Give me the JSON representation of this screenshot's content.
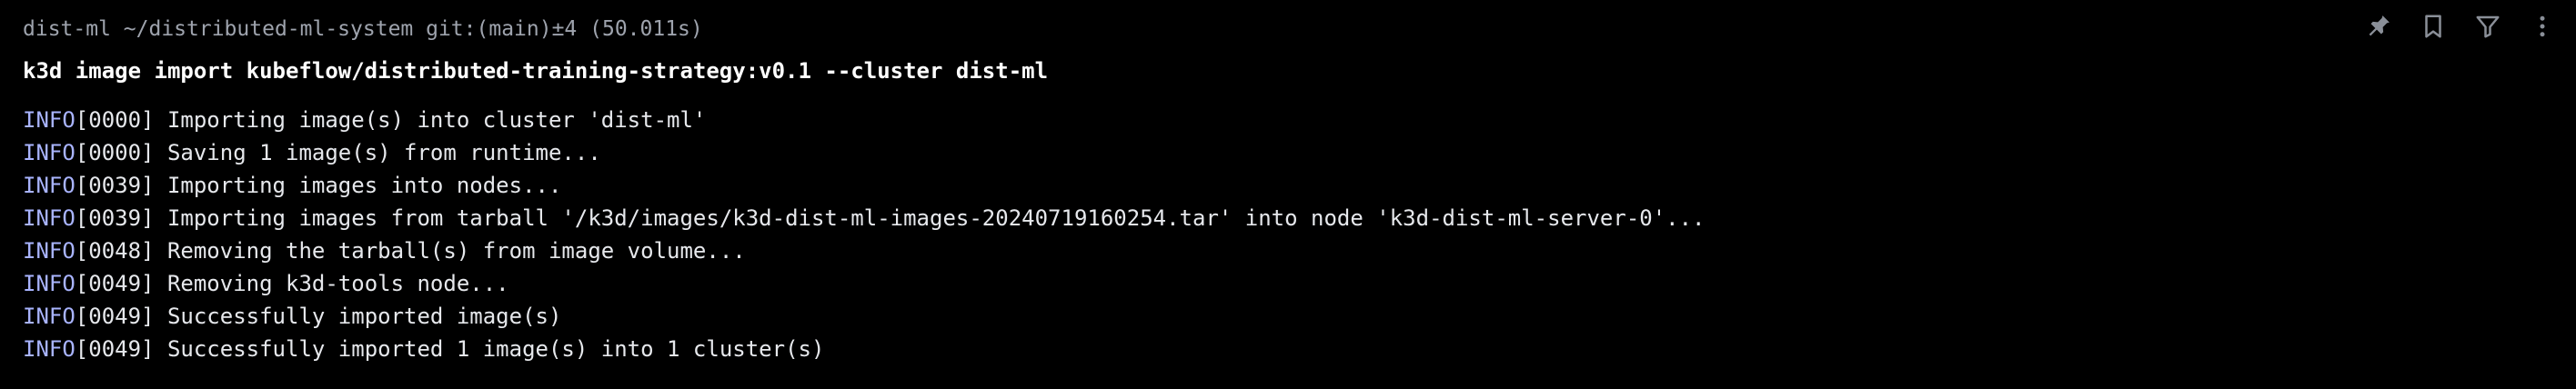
{
  "prompt": {
    "text": "dist-ml ~/distributed-ml-system git:(main)±4 (50.011s)"
  },
  "command": {
    "text": "k3d image import kubeflow/distributed-training-strategy:v0.1 --cluster dist-ml"
  },
  "output": [
    {
      "level": "INFO",
      "code": "[0000]",
      "message": " Importing image(s) into cluster 'dist-ml'"
    },
    {
      "level": "INFO",
      "code": "[0000]",
      "message": " Saving 1 image(s) from runtime..."
    },
    {
      "level": "INFO",
      "code": "[0039]",
      "message": " Importing images into nodes..."
    },
    {
      "level": "INFO",
      "code": "[0039]",
      "message": " Importing images from tarball '/k3d/images/k3d-dist-ml-images-20240719160254.tar' into node 'k3d-dist-ml-server-0'..."
    },
    {
      "level": "INFO",
      "code": "[0048]",
      "message": " Removing the tarball(s) from image volume..."
    },
    {
      "level": "INFO",
      "code": "[0049]",
      "message": " Removing k3d-tools node..."
    },
    {
      "level": "INFO",
      "code": "[0049]",
      "message": " Successfully imported image(s)"
    },
    {
      "level": "INFO",
      "code": "[0049]",
      "message": " Successfully imported 1 image(s) into 1 cluster(s)"
    }
  ],
  "toolbar": {
    "icons": [
      "pin-icon",
      "bookmark-icon",
      "filter-icon",
      "more-vertical-icon"
    ],
    "icon_color": "#8a8f98"
  },
  "colors": {
    "background": "#000000",
    "info_level": "#a9b4ff",
    "prompt": "#9ea3ad",
    "command": "#ffffff"
  }
}
